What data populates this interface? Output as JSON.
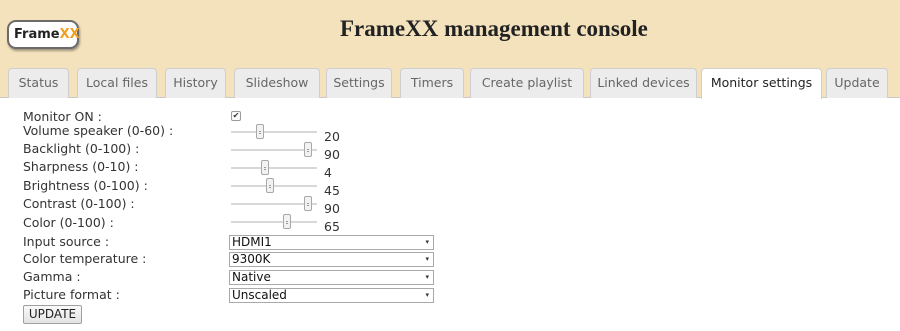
{
  "header": {
    "logo_frame": "Frame",
    "logo_xx": "XX",
    "title": "FrameXX management console"
  },
  "tabs": [
    {
      "label": "Status"
    },
    {
      "label": "Local files"
    },
    {
      "label": "History"
    },
    {
      "label": "Slideshow"
    },
    {
      "label": "Settings"
    },
    {
      "label": "Timers"
    },
    {
      "label": "Create playlist"
    },
    {
      "label": "Linked devices"
    },
    {
      "label": "Monitor settings",
      "active": true
    },
    {
      "label": "Update"
    }
  ],
  "form": {
    "monitor_on": {
      "label": "Monitor ON :",
      "checked": true,
      "mark": "✔"
    },
    "sliders": [
      {
        "label": "Volume speaker (0-60) :",
        "min": 0,
        "max": 60,
        "value": "20",
        "fraction": 0.333
      },
      {
        "label": "Backlight (0-100) :",
        "min": 0,
        "max": 100,
        "value": "90",
        "fraction": 0.9
      },
      {
        "label": "Sharpness (0-10) :",
        "min": 0,
        "max": 10,
        "value": "4",
        "fraction": 0.4
      },
      {
        "label": "Brightness (0-100) :",
        "min": 0,
        "max": 100,
        "value": "45",
        "fraction": 0.45
      },
      {
        "label": "Contrast (0-100) :",
        "min": 0,
        "max": 100,
        "value": "90",
        "fraction": 0.9
      },
      {
        "label": "Color (0-100) :",
        "min": 0,
        "max": 100,
        "value": "65",
        "fraction": 0.65
      }
    ],
    "selects": [
      {
        "label": "Input source :",
        "value": "HDMI1"
      },
      {
        "label": "Color temperature :",
        "value": "9300K"
      },
      {
        "label": "Gamma :",
        "value": "Native"
      },
      {
        "label": "Picture format :",
        "value": "Unscaled"
      }
    ],
    "update_button": "UPDATE"
  },
  "icons": {
    "dropdown_arrow": "▾"
  },
  "colors": {
    "header_bg": "#f4e2bd",
    "logo_accent": "#f0a020"
  }
}
